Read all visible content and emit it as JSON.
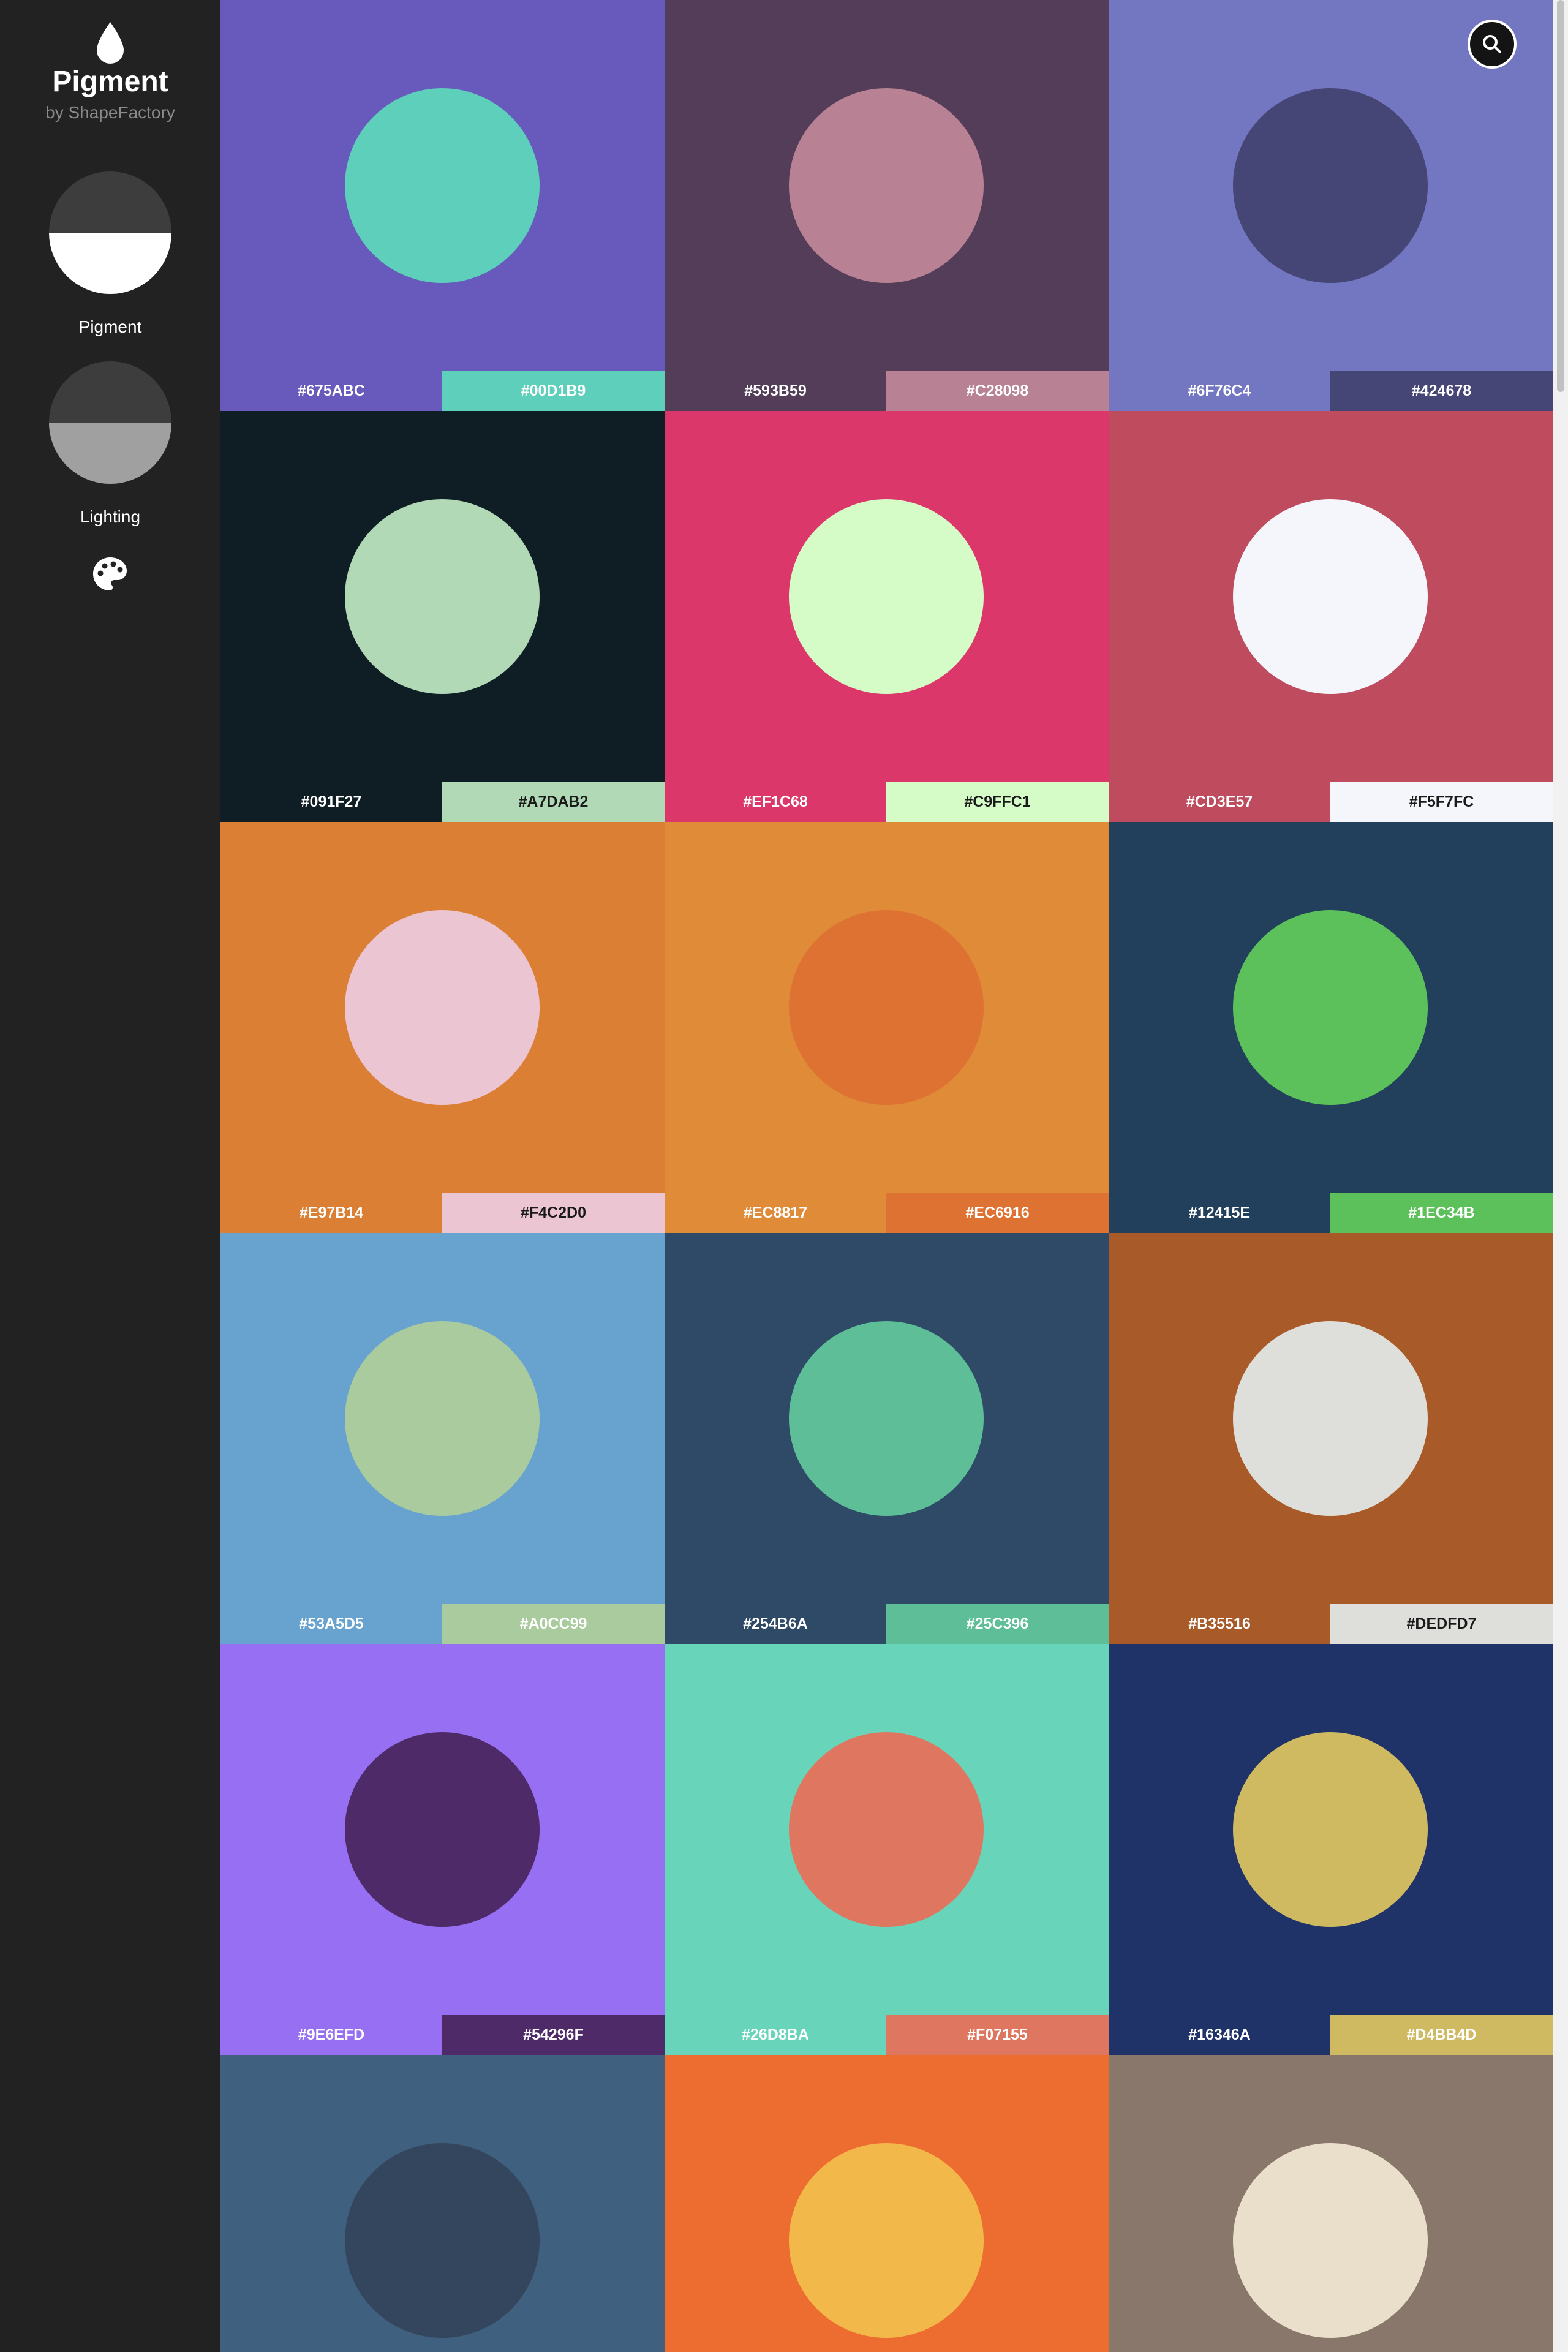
{
  "app": {
    "title": "Pigment",
    "subtitle": "by ShapeFactory"
  },
  "sidebar": {
    "modes": [
      {
        "label": "Pigment",
        "top_color": "#3d3d3d",
        "bottom_color": "#ffffff",
        "selected": true
      },
      {
        "label": "Lighting",
        "top_color": "#3d3d3d",
        "bottom_color": "#a0a0a0",
        "selected": false
      }
    ],
    "palette_icon": "palette-icon",
    "logo_icon": "drop-icon"
  },
  "search": {
    "icon": "search-icon"
  },
  "pairs": [
    {
      "primary": "#675ABC",
      "secondary": "#00D1B9",
      "bg": "#675abc",
      "dot": "#5dcfba",
      "text1": "#ffffff",
      "text2": "#ffffff"
    },
    {
      "primary": "#593B59",
      "secondary": "#C28098",
      "bg": "#543d58",
      "dot": "#b88294",
      "text1": "#ffffff",
      "text2": "#ffffff"
    },
    {
      "primary": "#6F76C4",
      "secondary": "#424678",
      "bg": "#7376c0",
      "dot": "#454676",
      "text1": "#ffffff",
      "text2": "#ffffff"
    },
    {
      "primary": "#091F27",
      "secondary": "#A7DAB2",
      "bg": "#0f1e25",
      "dot": "#b1d9b6",
      "text1": "#ffffff",
      "text2": "#1a1a1a"
    },
    {
      "primary": "#EF1C68",
      "secondary": "#C9FFC1",
      "bg": "#db376b",
      "dot": "#d5fcc7",
      "text1": "#ffffff",
      "text2": "#1a1a1a"
    },
    {
      "primary": "#CD3E57",
      "secondary": "#F5F7FC",
      "bg": "#be4b5e",
      "dot": "#f5f6fb",
      "text1": "#ffffff",
      "text2": "#1a1a1a"
    },
    {
      "primary": "#E97B14",
      "secondary": "#F4C2D0",
      "bg": "#da7f33",
      "dot": "#ecc5d2",
      "text1": "#ffffff",
      "text2": "#1a1a1a"
    },
    {
      "primary": "#EC8817",
      "secondary": "#EC6916",
      "bg": "#df8b38",
      "dot": "#de7232",
      "text1": "#ffffff",
      "text2": "#ffffff"
    },
    {
      "primary": "#12415E",
      "secondary": "#1EC34B",
      "bg": "#22405b",
      "dot": "#5cc05b",
      "text1": "#ffffff",
      "text2": "#ffffff"
    },
    {
      "primary": "#53A5D5",
      "secondary": "#A0CC99",
      "bg": "#68a3d0",
      "dot": "#a9cb9d",
      "text1": "#ffffff",
      "text2": "#ffffff"
    },
    {
      "primary": "#254B6A",
      "secondary": "#25C396",
      "bg": "#2e4a67",
      "dot": "#5dbe98",
      "text1": "#ffffff",
      "text2": "#ffffff"
    },
    {
      "primary": "#B35516",
      "secondary": "#DEDFD7",
      "bg": "#a85a28",
      "dot": "#dededa",
      "text1": "#ffffff",
      "text2": "#1a1a1a"
    },
    {
      "primary": "#9E6EFD",
      "secondary": "#54296F",
      "bg": "#966ff3",
      "dot": "#4e2a68",
      "text1": "#ffffff",
      "text2": "#ffffff"
    },
    {
      "primary": "#26D8BA",
      "secondary": "#F07155",
      "bg": "#68d5bb",
      "dot": "#df765f",
      "text1": "#ffffff",
      "text2": "#ffffff"
    },
    {
      "primary": "#16346A",
      "secondary": "#D4BB4D",
      "bg": "#1f3369",
      "dot": "#cfb961",
      "text1": "#ffffff",
      "text2": "#ffffff"
    },
    {
      "primary": "",
      "secondary": "",
      "bg": "#40607f",
      "dot": "#33465d",
      "text1": "#ffffff",
      "text2": "#ffffff"
    },
    {
      "primary": "",
      "secondary": "",
      "bg": "#ed6d30",
      "dot": "#f3b84a",
      "text1": "#ffffff",
      "text2": "#ffffff"
    },
    {
      "primary": "",
      "secondary": "",
      "bg": "#8a776b",
      "dot": "#e9dfca",
      "text1": "#ffffff",
      "text2": "#ffffff"
    }
  ]
}
